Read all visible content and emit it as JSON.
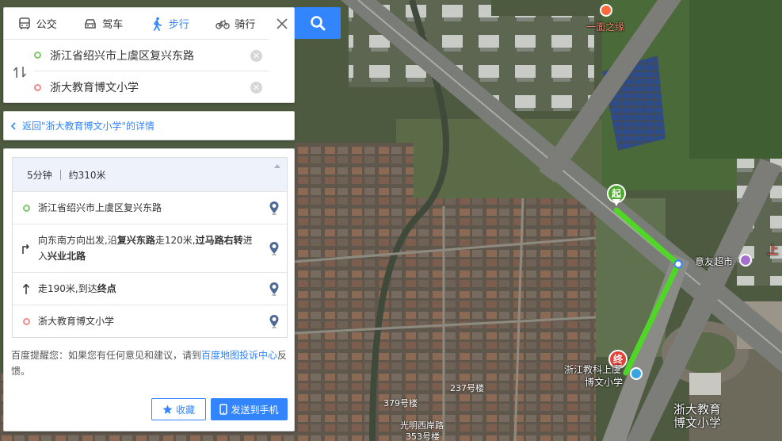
{
  "tabs": [
    {
      "label": "公交",
      "icon": "bus-icon"
    },
    {
      "label": "驾车",
      "icon": "car-icon"
    },
    {
      "label": "步行",
      "icon": "walk-icon",
      "active": true
    },
    {
      "label": "骑行",
      "icon": "bike-icon"
    }
  ],
  "route": {
    "start_value": "浙江省绍兴市上虞区复兴东路",
    "end_value": "浙大教育博文小学",
    "clear_glyph": "✕"
  },
  "back_link": "返回\"浙大教育博文小学\"的详情",
  "summary": {
    "duration": "5分钟",
    "distance": "约310米"
  },
  "steps": {
    "start": "浙江省绍兴市上虞区复兴东路",
    "step1": {
      "p1": "向东南方向出发,沿",
      "road1": "复兴东路",
      "p2": "走120米,",
      "turn": "过马路右转",
      "p3": "进入",
      "road2": "兴业北路"
    },
    "step2": {
      "p1": "走190米,到达",
      "dest": "终点"
    },
    "end": "浙大教育博文小学"
  },
  "tip": {
    "prefix": "百度提醒您：如果您有任何意见和建议，请到",
    "link": "百度地图投诉中心",
    "suffix": "反馈。"
  },
  "buttons": {
    "favorite": "收藏",
    "send": "发送到手机"
  },
  "map": {
    "markers": {
      "start": "起",
      "end": "终"
    },
    "labels": {
      "noodle_shop": "一面之缘",
      "supermarket": "意友超市",
      "school_small_1": "浙江教科上虞",
      "school_small_2": "博文小学",
      "school_big_1": "浙大教育",
      "school_big_2": "博文小学",
      "bld_379": "379号楼",
      "bld_237": "237号楼",
      "road_bottom": "光明西岸路",
      "bld_353": "353号楼",
      "edge_text": "上"
    }
  },
  "colors": {
    "accent": "#3385ff",
    "route": "#4fd626",
    "start_marker": "#4ca92c",
    "end_marker": "#e2423a",
    "start_dot": "#7cc96e",
    "end_dot": "#f08a8a"
  }
}
